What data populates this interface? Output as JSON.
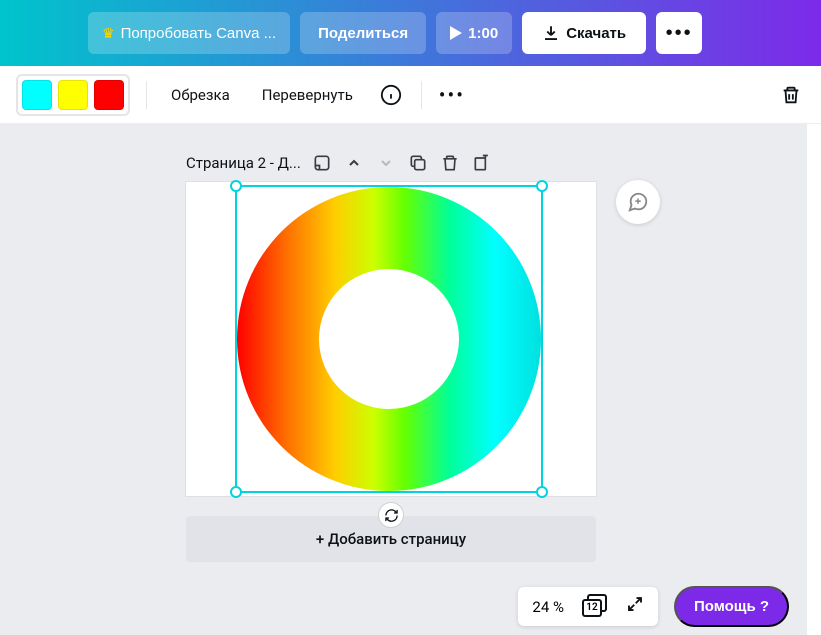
{
  "topbar": {
    "try_label": "Попробовать Canva ...",
    "share_label": "Поделиться",
    "play_duration": "1:00",
    "download_label": "Скачать"
  },
  "toolbar": {
    "colors": [
      "#00ffff",
      "#ffff00",
      "#ff0000"
    ],
    "crop_label": "Обрезка",
    "flip_label": "Перевернуть"
  },
  "canvas": {
    "page_label": "Страница 2 - Д..."
  },
  "add_page_label": "+ Добавить страницу",
  "bottom": {
    "zoom": "24 %",
    "page_count": "12",
    "help_label": "Помощь ?"
  }
}
